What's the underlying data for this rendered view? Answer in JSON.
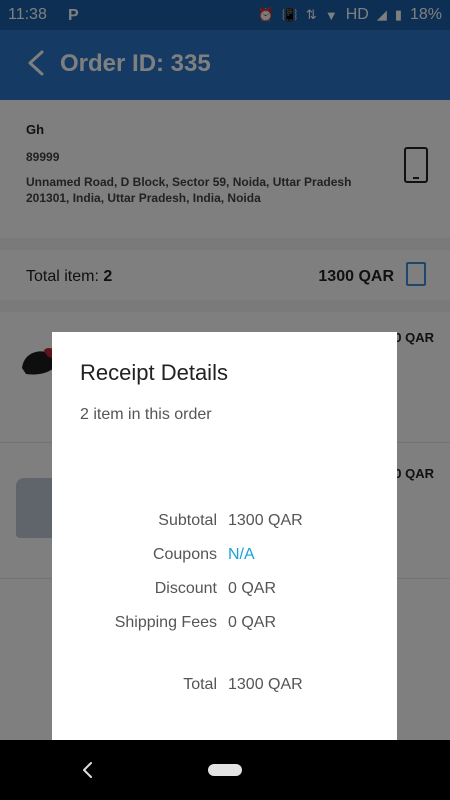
{
  "status_bar": {
    "time": "11:38",
    "app_badge": "P",
    "indicators": [
      "alarm-icon",
      "vibrate-icon",
      "data-icon",
      "wifi-icon"
    ],
    "network": "HD",
    "battery": "18%"
  },
  "header": {
    "title": "Order ID: 335"
  },
  "address": {
    "name": "Gh",
    "phone": "89999",
    "line": "Unnamed Road, D Block, Sector 59, Noida, Uttar Pradesh 201301, India, Uttar Pradesh, India, Noida"
  },
  "summary": {
    "total_item_label": "Total item:",
    "total_item_count": "2",
    "total_amount": "1300 QAR"
  },
  "items": [
    {
      "price": "0 QAR"
    },
    {
      "price": "0 QAR"
    }
  ],
  "dialog": {
    "title": "Receipt Details",
    "subtitle": "2 item in this order",
    "rows": [
      {
        "label": "Subtotal",
        "value": "1300 QAR"
      },
      {
        "label": "Coupons",
        "value": "N/A"
      },
      {
        "label": "Discount",
        "value": "0 QAR"
      },
      {
        "label": "Shipping Fees",
        "value": "0 QAR"
      }
    ],
    "total_label": "Total",
    "total_value": "1300 QAR"
  },
  "colors": {
    "status_bar": "#1a5ea8",
    "app_bar": "#2a76c9",
    "coupon_link": "#16a3d9"
  }
}
